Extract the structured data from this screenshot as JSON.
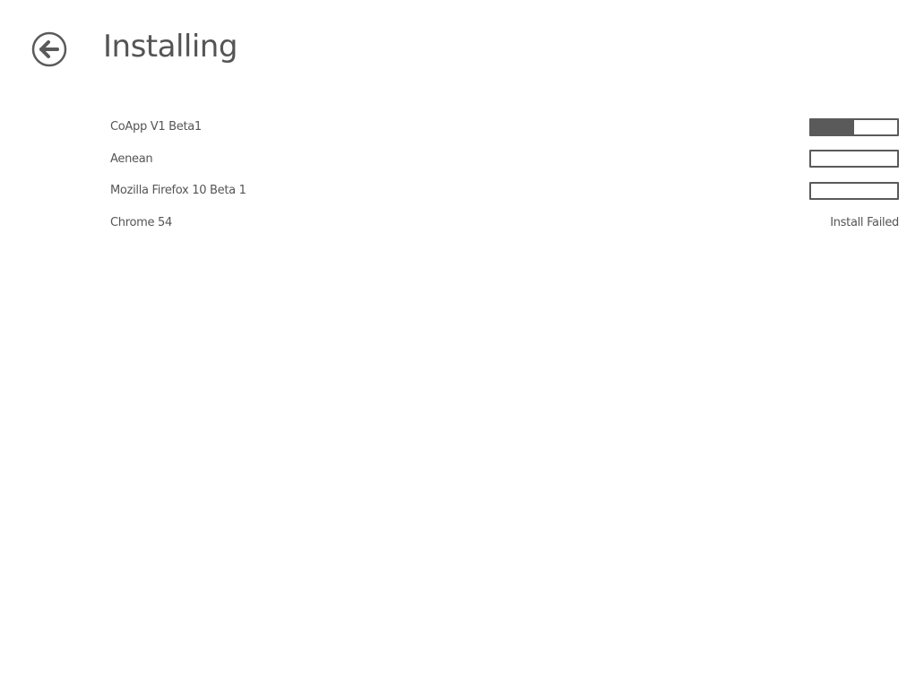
{
  "header": {
    "title": "Installing",
    "back_icon": "back-arrow-circle-icon"
  },
  "colors": {
    "ink": "#5a5a5a",
    "background": "#ffffff"
  },
  "install_items": [
    {
      "name": "CoApp V1 Beta1",
      "progress": 0.5,
      "status": ""
    },
    {
      "name": "Aenean",
      "progress": 0,
      "status": ""
    },
    {
      "name": "Mozilla Firefox 10 Beta 1",
      "progress": 0,
      "status": ""
    },
    {
      "name": "Chrome 54",
      "progress": null,
      "status": "Install Failed"
    }
  ]
}
